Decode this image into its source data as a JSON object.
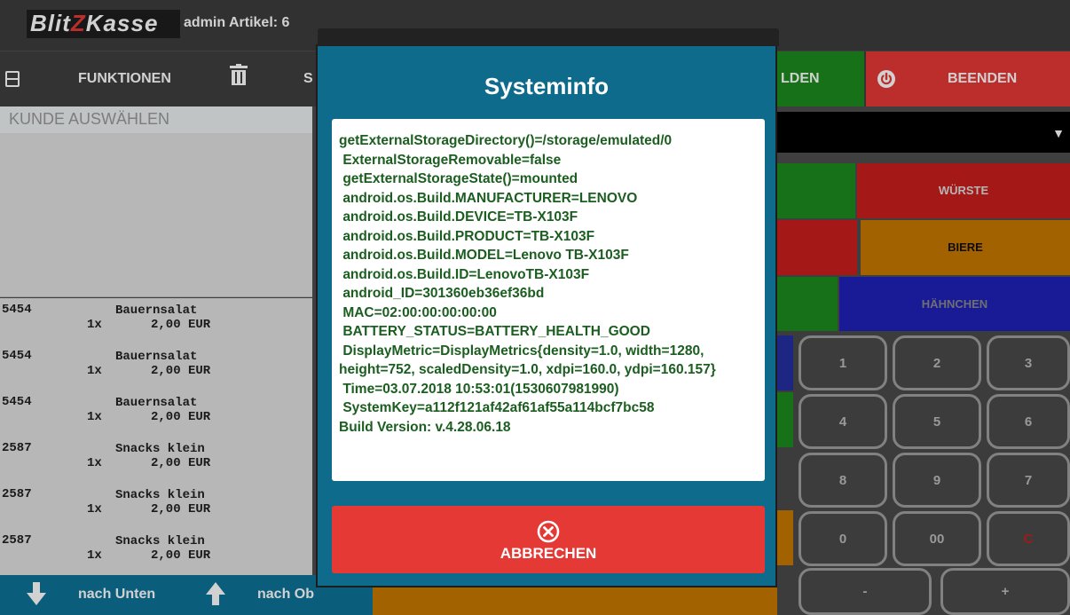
{
  "app": {
    "logo_text_a": "Blit",
    "logo_text_z": "Z",
    "logo_text_b": "Kasse",
    "info": "admin Artikel: 6"
  },
  "menu": {
    "funktionen": "FUNKTIONEN",
    "s_partial": "S",
    "melden_partial": "LDEN",
    "beenden": "BEENDEN"
  },
  "customer": {
    "placeholder": "KUNDE AUSWÄHLEN"
  },
  "cart": [
    {
      "code": "5454",
      "name": "Bauernsalat",
      "qty": "1x",
      "price": "2,00 EUR"
    },
    {
      "code": "5454",
      "name": "Bauernsalat",
      "qty": "1x",
      "price": "2,00 EUR"
    },
    {
      "code": "5454",
      "name": "Bauernsalat",
      "qty": "1x",
      "price": "2,00 EUR"
    },
    {
      "code": "2587",
      "name": "Snacks klein",
      "qty": "1x",
      "price": "2,00 EUR"
    },
    {
      "code": "2587",
      "name": "Snacks klein",
      "qty": "1x",
      "price": "2,00 EUR"
    },
    {
      "code": "2587",
      "name": "Snacks klein",
      "qty": "1x",
      "price": "2,00 EUR"
    }
  ],
  "bottom": {
    "down": "nach Unten",
    "up": "nach Ob"
  },
  "categories": {
    "wurste": "WÜRSTE",
    "biere": "BIERE",
    "hahnchen": "HÄHNCHEN"
  },
  "keypad": {
    "k1": "1",
    "k2": "2",
    "k3": "3",
    "k4": "4",
    "k5": "5",
    "k6": "6",
    "k8": "8",
    "k9": "9",
    "k7": "7",
    "k0": "0",
    "k00": "00",
    "kc": "C",
    "kminus": "-",
    "kplus": "+"
  },
  "modal": {
    "title": "Systeminfo",
    "info_lines": "getExternalStorageDirectory()=/storage/emulated/0\n ExternalStorageRemovable=false\n getExternalStorageState()=mounted\n android.os.Build.MANUFACTURER=LENOVO\n android.os.Build.DEVICE=TB-X103F\n android.os.Build.PRODUCT=TB-X103F\n android.os.Build.MODEL=Lenovo TB-X103F\n android.os.Build.ID=LenovoTB-X103F\n android_ID=301360eb36ef36bd\n MAC=02:00:00:00:00:00\n BATTERY_STATUS=BATTERY_HEALTH_GOOD\n DisplayMetric=DisplayMetrics{density=1.0, width=1280, height=752, scaledDensity=1.0, xdpi=160.0, ydpi=160.157}\n Time=03.07.2018 10:53:01(1530607981990)\n SystemKey=a112f121af42af61af55a114bcf7bc58\nBuild Version: v.4.28.06.18",
    "cancel_label": "ABBRECHEN"
  },
  "colors": {
    "accent_teal": "#0e6b8c",
    "cancel_red": "#e53935",
    "info_text_green": "#1b5e20"
  }
}
